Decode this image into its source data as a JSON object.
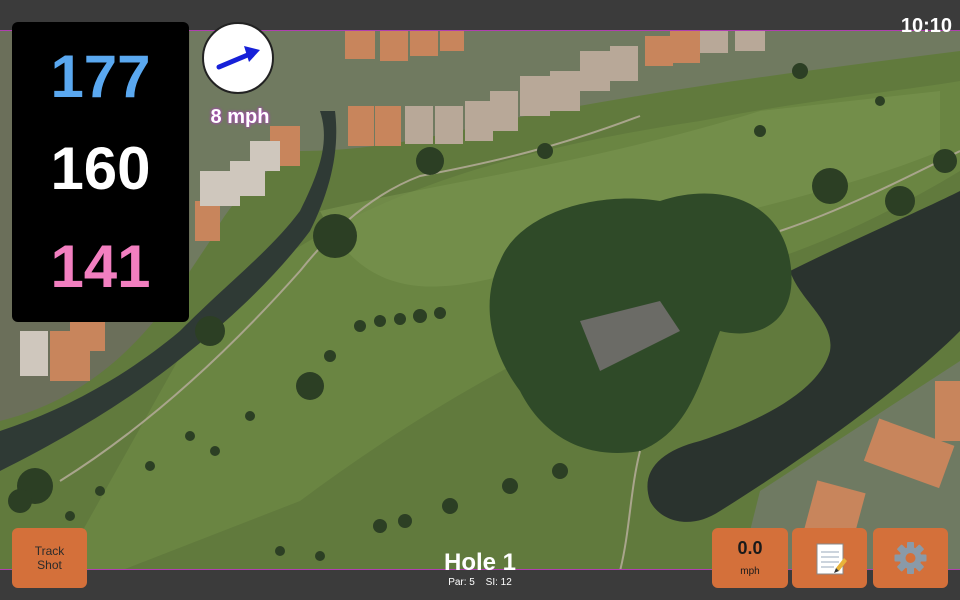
{
  "status": {
    "time": "10:10"
  },
  "yardage": {
    "back": "177",
    "middle": "160",
    "front": "141"
  },
  "wind": {
    "speed_label": "8 mph",
    "direction_icon": "wind-arrow-icon"
  },
  "hole": {
    "title": "Hole 1",
    "par_label": "Par: 5",
    "si_label": "SI: 12"
  },
  "buttons": {
    "track_line1": "Track",
    "track_line2": "Shot",
    "shot_speed_value": "0.0",
    "shot_speed_unit": "mph",
    "notes_icon": "notepad-icon",
    "settings_icon": "gear-icon"
  },
  "colors": {
    "back": "#5aa8f0",
    "middle": "#ffffff",
    "front": "#f27fc0",
    "button": "#d4703a",
    "accent": "#b03fb0"
  }
}
